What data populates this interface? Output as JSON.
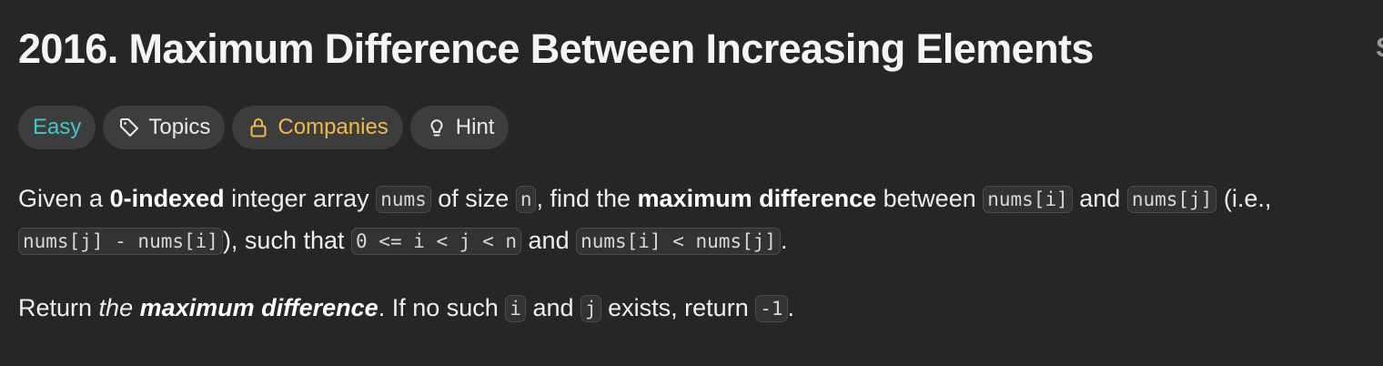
{
  "problem": {
    "title": "2016. Maximum Difference Between Increasing Elements",
    "edge_glyph": "S"
  },
  "tags": {
    "difficulty": "Easy",
    "topics": "Topics",
    "companies": "Companies",
    "hint": "Hint"
  },
  "colors": {
    "background": "#262626",
    "easy": "#46c6c2",
    "companies": "#f0b94e",
    "chip_bg": "#3d3d3d"
  },
  "icons": {
    "topics": "tag-icon",
    "companies": "lock-icon",
    "hint": "lightbulb-icon"
  },
  "description": {
    "p1": {
      "t1": "Given a ",
      "b1": "0-indexed",
      "t2": " integer array ",
      "c1": "nums",
      "t3": " of size ",
      "c2": "n",
      "t4": ", find the ",
      "b2": "maximum difference",
      "t5": " between ",
      "c3": "nums[i]",
      "t6": " and ",
      "c4": "nums[j]",
      "t7": " (i.e.,",
      "c5": "nums[j] - nums[i]",
      "t8": "), such that ",
      "c6": "0 <= i < j < n",
      "t9": " and ",
      "c7": "nums[i] < nums[j]",
      "t10": "."
    },
    "p2": {
      "t1": "Return ",
      "i1": "the ",
      "ib1": "maximum difference",
      "t2": ". If no such ",
      "c1": "i",
      "t3": " and ",
      "c2": "j",
      "t4": " exists, return ",
      "c3": "-1",
      "t5": "."
    }
  }
}
